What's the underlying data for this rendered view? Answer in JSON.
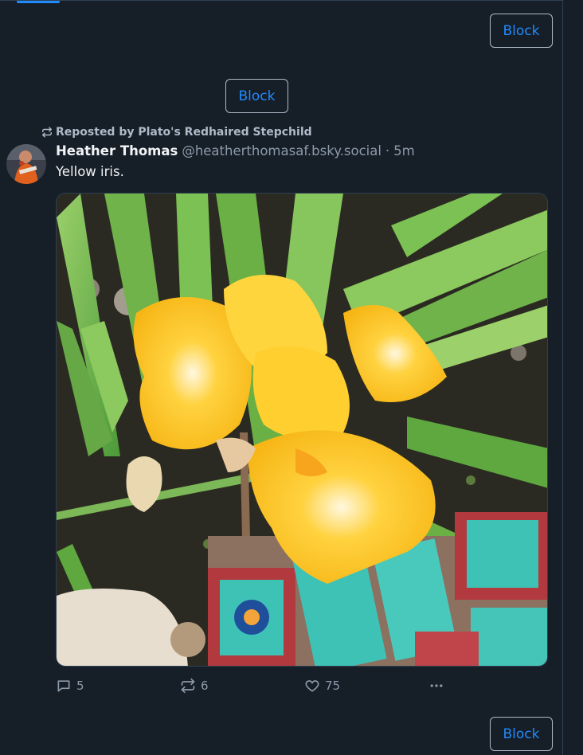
{
  "buttons": {
    "block_top": "Block",
    "block_middle": "Block",
    "block_bottom": "Block"
  },
  "post": {
    "repost_label": "Reposted by Plato's Redhaired Stepchild",
    "author_name": "Heather Thomas",
    "author_handle": "@heatherthomasaf.bsky.social",
    "separator": "·",
    "time": "5m",
    "text": "Yellow iris.",
    "image_alt_subject": "yellow-iris-photo",
    "counts": {
      "replies": "5",
      "reposts": "6",
      "likes": "75"
    }
  },
  "icons": {
    "repost": "repost-icon",
    "reply": "reply-icon",
    "like": "heart-icon",
    "more": "more-icon"
  },
  "colors": {
    "background": "#161e27",
    "accent": "#208bfe",
    "muted": "#8c9baa",
    "border": "#2e4052"
  }
}
